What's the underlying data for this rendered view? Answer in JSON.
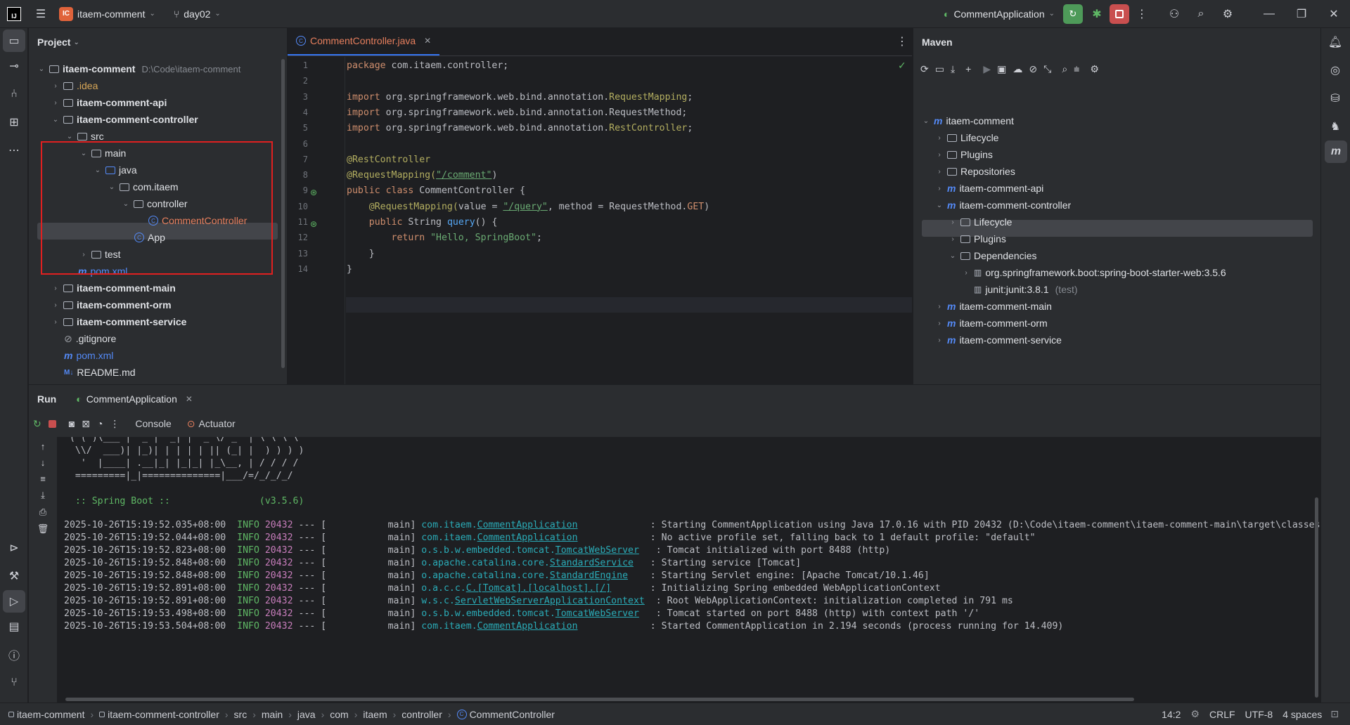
{
  "titlebar": {
    "project_badge": "IC",
    "project_name": "itaem-comment",
    "branch": "day02",
    "run_config": "CommentApplication"
  },
  "project": {
    "title": "Project",
    "tree": [
      {
        "label": "itaem-comment",
        "suffix": "D:\\Code\\itaem-comment"
      },
      {
        "label": ".idea"
      },
      {
        "label": "itaem-comment-api"
      },
      {
        "label": "itaem-comment-controller"
      },
      {
        "label": "src"
      },
      {
        "label": "main"
      },
      {
        "label": "java"
      },
      {
        "label": "com.itaem"
      },
      {
        "label": "controller"
      },
      {
        "label": "CommentController"
      },
      {
        "label": "App"
      },
      {
        "label": "test"
      },
      {
        "label": "pom.xml"
      },
      {
        "label": "itaem-comment-main"
      },
      {
        "label": "itaem-comment-orm"
      },
      {
        "label": "itaem-comment-service"
      },
      {
        "label": ".gitignore"
      },
      {
        "label": "pom.xml"
      },
      {
        "label": "README.md"
      }
    ]
  },
  "editor": {
    "tab": "CommentController.java",
    "line_numbers": [
      "1",
      "2",
      "3",
      "4",
      "5",
      "6",
      "7",
      "8",
      "9",
      "10",
      "11",
      "12",
      "13",
      "14"
    ],
    "code": {
      "l1_kw": "package",
      "l1_rest": " com.itaem.controller;",
      "l3_kw": "import",
      "l3_pkg": " org.springframework.web.bind.annotation.",
      "l3_cls": "RequestMapping",
      "l4_kw": "import",
      "l4_pkg": " org.springframework.web.bind.annotation.",
      "l4_cls": "RequestMethod;",
      "l5_kw": "import",
      "l5_pkg": " org.springframework.web.bind.annotation.",
      "l5_cls": "RestController",
      "l7": "@RestController",
      "l8_ann": "@RequestMapping(",
      "l8_str": "\"/comment\"",
      "l8_end": ")",
      "l9_kw": "public class",
      "l9_rest": " CommentController {",
      "l10_ann": "@RequestMapping(",
      "l10_a": "value = ",
      "l10_str": "\"/query\"",
      "l10_b": ", method = RequestMethod.",
      "l10_get": "GET",
      "l10_end": ")",
      "l11_kw": "public",
      "l11_a": " String ",
      "l11_fn": "query",
      "l11_b": "() {",
      "l12_kw": "return",
      "l12_str": " \"Hello, SpringBoot\"",
      "l12_end": ";",
      "l13": "}",
      "l14": "}"
    }
  },
  "maven": {
    "title": "Maven",
    "tree": [
      "itaem-comment",
      "Lifecycle",
      "Plugins",
      "Repositories",
      "itaem-comment-api",
      "itaem-comment-controller",
      "Lifecycle",
      "Plugins",
      "Dependencies",
      "org.springframework.boot:spring-boot-starter-web:3.5.6",
      "junit:junit:3.8.1",
      "itaem-comment-main",
      "itaem-comment-orm",
      "itaem-comment-service"
    ],
    "junit_scope": "(test)"
  },
  "run": {
    "tab_run": "Run",
    "tab_app": "CommentApplication",
    "tab_console": "Console",
    "tab_actuator": "Actuator",
    "banner": [
      " ( ( )\\___ | '_ | '_| | '_ \\/ _` | \\ \\ \\ \\",
      "  \\\\/  ___)| |_)| | | | | || (_| |  ) ) ) )",
      "   '  |____| .__|_| |_|_| |_\\__, | / / / /",
      "  =========|_|==============|___/=/_/_/_/",
      "",
      "  :: Spring Boot ::                (v3.5.6)"
    ],
    "logs": [
      {
        "ts": "2025-10-26T15:19:52.035+08:00",
        "lvl": "INFO",
        "pid": "20432",
        "th": "---",
        "thread": "[           main]",
        "lg_pre": "com.itaem.",
        "lg_cls": "CommentApplication",
        "pad": "            ",
        "msg": ": Starting CommentApplication using Java 17.0.16 with PID 20432 (D:\\Code\\itaem-comment\\itaem-comment-main\\target\\classes"
      },
      {
        "ts": "2025-10-26T15:19:52.044+08:00",
        "lvl": "INFO",
        "pid": "20432",
        "th": "---",
        "thread": "[           main]",
        "lg_pre": "com.itaem.",
        "lg_cls": "CommentApplication",
        "pad": "            ",
        "msg": ": No active profile set, falling back to 1 default profile: \"default\""
      },
      {
        "ts": "2025-10-26T15:19:52.823+08:00",
        "lvl": "INFO",
        "pid": "20432",
        "th": "---",
        "thread": "[           main]",
        "lg_pre": "o.s.b.w.embedded.tomcat.",
        "lg_cls": "TomcatWebServer",
        "pad": "  ",
        "msg": ": Tomcat initialized with port 8488 (http)"
      },
      {
        "ts": "2025-10-26T15:19:52.848+08:00",
        "lvl": "INFO",
        "pid": "20432",
        "th": "---",
        "thread": "[           main]",
        "lg_pre": "o.apache.catalina.core.",
        "lg_cls": "StandardService",
        "pad": "  ",
        "msg": ": Starting service [Tomcat]"
      },
      {
        "ts": "2025-10-26T15:19:52.848+08:00",
        "lvl": "INFO",
        "pid": "20432",
        "th": "---",
        "thread": "[           main]",
        "lg_pre": "o.apache.catalina.core.",
        "lg_cls": "StandardEngine",
        "pad": "   ",
        "msg": ": Starting Servlet engine: [Apache Tomcat/10.1.46]"
      },
      {
        "ts": "2025-10-26T15:19:52.891+08:00",
        "lvl": "INFO",
        "pid": "20432",
        "th": "---",
        "thread": "[           main]",
        "lg_pre": "o.a.c.c.",
        "lg_cls": "C.[Tomcat].[localhost].[/]",
        "pad": "      ",
        "msg": ": Initializing Spring embedded WebApplicationContext"
      },
      {
        "ts": "2025-10-26T15:19:52.891+08:00",
        "lvl": "INFO",
        "pid": "20432",
        "th": "---",
        "thread": "[           main]",
        "lg_pre": "w.s.c.",
        "lg_cls": "ServletWebServerApplicationContext",
        "pad": " ",
        "msg": ": Root WebApplicationContext: initialization completed in 791 ms"
      },
      {
        "ts": "2025-10-26T15:19:53.498+08:00",
        "lvl": "INFO",
        "pid": "20432",
        "th": "---",
        "thread": "[           main]",
        "lg_pre": "o.s.b.w.embedded.tomcat.",
        "lg_cls": "TomcatWebServer",
        "pad": "  ",
        "msg": ": Tomcat started on port 8488 (http) with context path '/'"
      },
      {
        "ts": "2025-10-26T15:19:53.504+08:00",
        "lvl": "INFO",
        "pid": "20432",
        "th": "---",
        "thread": "[           main]",
        "lg_pre": "com.itaem.",
        "lg_cls": "CommentApplication",
        "pad": "            ",
        "msg": ": Started CommentApplication in 2.194 seconds (process running for 14.409)"
      }
    ]
  },
  "statusbar": {
    "crumbs": [
      "itaem-comment",
      "itaem-comment-controller",
      "src",
      "main",
      "java",
      "com",
      "itaem",
      "controller",
      "CommentController"
    ],
    "position": "14:2",
    "line_sep": "CRLF",
    "encoding": "UTF-8",
    "indent": "4 spaces"
  },
  "colors": {
    "accent": "#3574f0",
    "highlight_box": "#e02020",
    "run_green": "#5fb865",
    "stop_red": "#db3b4b"
  }
}
